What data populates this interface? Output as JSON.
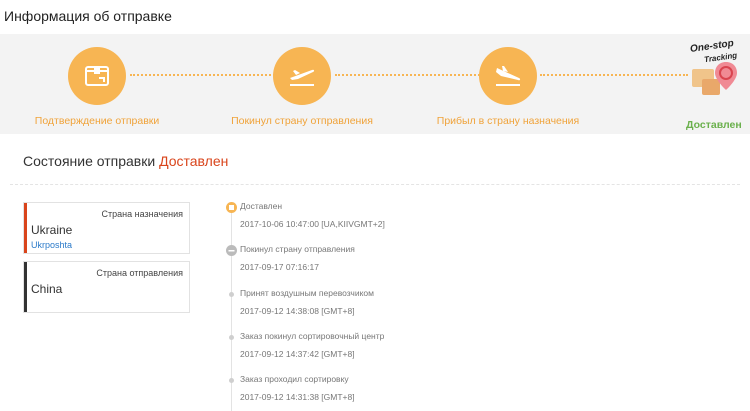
{
  "page_title": "Информация об отправке",
  "progress": {
    "steps": [
      {
        "label": "Подтверждение отправки",
        "icon": "package-icon"
      },
      {
        "label": "Покинул страну отправления",
        "icon": "plane-departure-icon"
      },
      {
        "label": "Прибыл в страну назначения",
        "icon": "plane-arrival-icon"
      },
      {
        "label": "Доставлен",
        "icon": "delivered-illustration"
      }
    ],
    "logo_line1": "One-stop",
    "logo_line2": "Tracking",
    "accent_color": "#f7b553",
    "done_color": "#6ab04c"
  },
  "status": {
    "label": "Состояние отправки",
    "value": "Доставлен"
  },
  "destination_card": {
    "caption": "Страна назначения",
    "country": "Ukraine",
    "carrier": "Ukrposhta",
    "bar_color": "#d9441b"
  },
  "origin_card": {
    "caption": "Страна отправления",
    "country": "China",
    "bar_color": "#333333"
  },
  "timeline": [
    {
      "title": "Доставлен",
      "time": "2017-10-06 10:47:00 [UA,KIIVGMT+2]",
      "icon": "delivered-marker-icon"
    },
    {
      "title": "Покинул страну отправления",
      "time": "2017-09-17 07:16:17",
      "icon": "departed-marker-icon"
    },
    {
      "title": "Принят воздушным перевозчиком",
      "time": "2017-09-12 14:38:08 [GMT+8]",
      "icon": "dot-icon"
    },
    {
      "title": "Заказ покинул сортировочный центр",
      "time": "2017-09-12 14:37:42 [GMT+8]",
      "icon": "dot-icon"
    },
    {
      "title": "Заказ проходил сортировку",
      "time": "2017-09-12 14:31:38 [GMT+8]",
      "icon": "dot-icon"
    }
  ]
}
